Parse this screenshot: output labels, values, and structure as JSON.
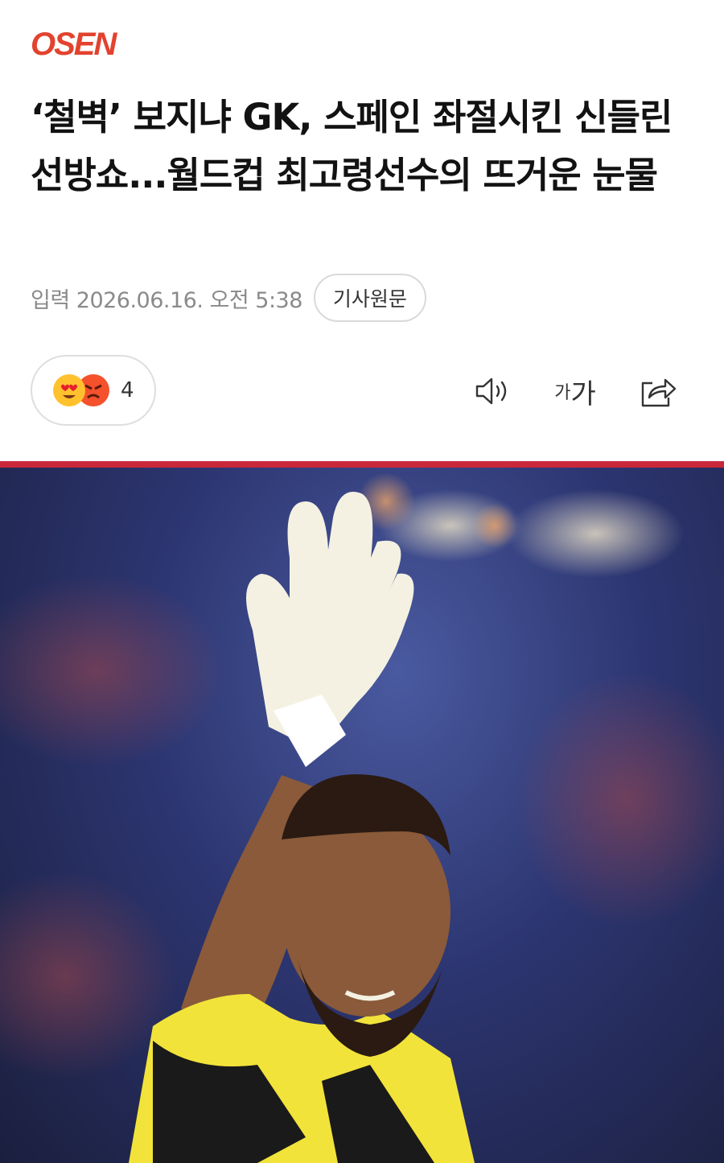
{
  "brand": {
    "logo_text": "OSEN",
    "logo_color": "#e2432f"
  },
  "article": {
    "headline": "‘철벽’ 보지냐 GK, 스페인 좌절시킨 신들린 선방쇼...월드컵 최고령선수의 뜨거운 눈물",
    "date": "입력 2026.06.16. 오전 5:38",
    "original_button": "기사원문"
  },
  "reactions": {
    "count": "4",
    "emojis": [
      "heart-eyes",
      "angry-face"
    ]
  },
  "toolbar": {
    "font_size_small": "가",
    "font_size_large": "가",
    "icons": [
      "speaker-icon",
      "font-size-icon",
      "share-icon"
    ]
  },
  "photo": {
    "subject": "goalkeeper-waving",
    "colors": {
      "jersey": "#f2e33a",
      "glove": "#f4f1e2",
      "background": "#2c3570"
    }
  }
}
